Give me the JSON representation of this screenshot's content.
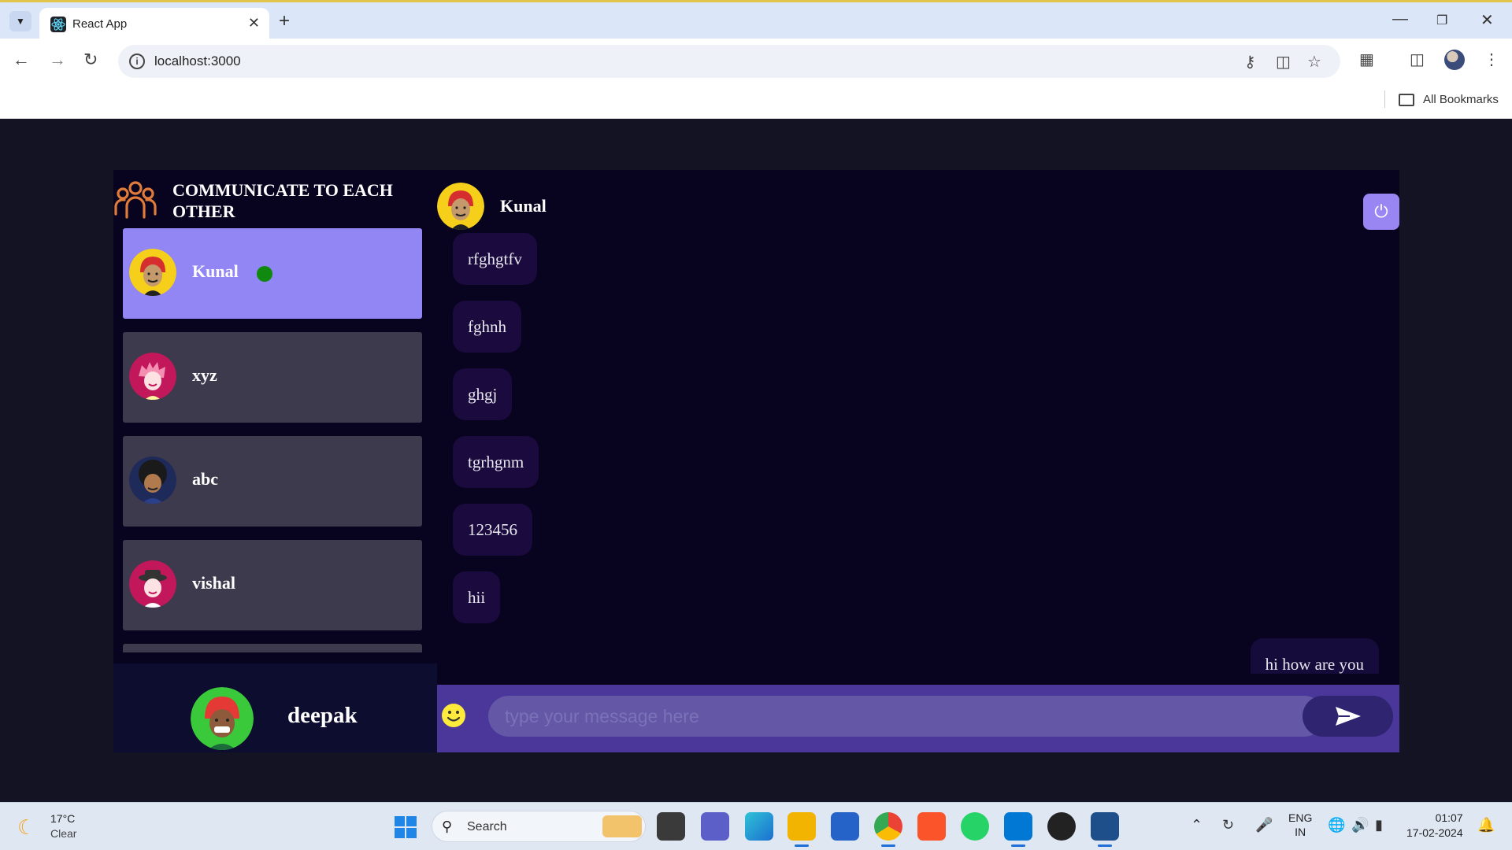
{
  "browser": {
    "tab_title": "React App",
    "url": "localhost:3000",
    "bookmarks_label": "All Bookmarks"
  },
  "app": {
    "brand_title": "COMMUNICATE TO EACH OTHER",
    "contacts": [
      {
        "name": "Kunal",
        "selected": true,
        "online": true
      },
      {
        "name": "xyz",
        "selected": false
      },
      {
        "name": "abc",
        "selected": false
      },
      {
        "name": "vishal",
        "selected": false
      }
    ],
    "current_user": "deepak",
    "chat": {
      "header_name": "Kunal",
      "messages": [
        {
          "text": "rfghgtfv",
          "direction": "received"
        },
        {
          "text": "fghnh",
          "direction": "received"
        },
        {
          "text": "ghgj",
          "direction": "received"
        },
        {
          "text": "tgrhgnm",
          "direction": "received"
        },
        {
          "text": "123456",
          "direction": "received"
        },
        {
          "text": "hii",
          "direction": "received"
        },
        {
          "text": "hi how are you",
          "direction": "sent"
        }
      ],
      "input_placeholder": "type your message here"
    },
    "colors": {
      "selected_contact": "#9186f3",
      "contact_bg": "#3e3a4e",
      "input_bar": "#4a3799",
      "online_dot": "#0f8a0f"
    }
  },
  "taskbar": {
    "weather_temp": "17°C",
    "weather_cond": "Clear",
    "search_label": "Search",
    "lang_line1": "ENG",
    "lang_line2": "IN",
    "time": "01:07",
    "date": "17-02-2024"
  }
}
